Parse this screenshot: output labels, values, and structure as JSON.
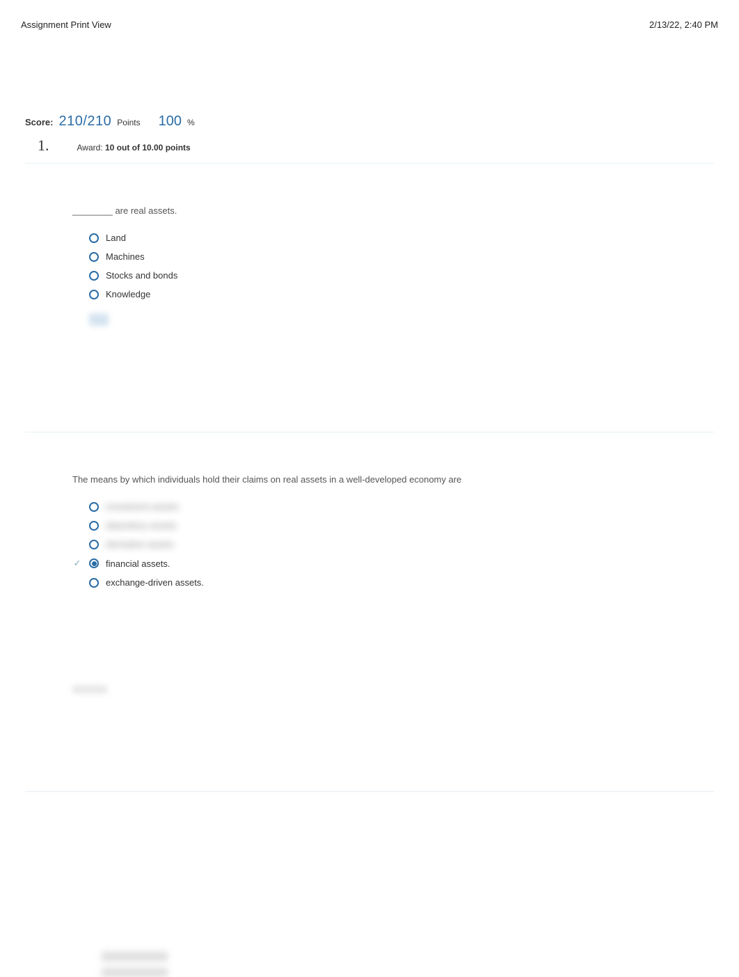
{
  "header": {
    "title": "Assignment Print View",
    "datetime": "2/13/22, 2:40 PM"
  },
  "score": {
    "label": "Score:",
    "value": "210/210",
    "points_label": "Points",
    "percent": "100",
    "percent_symbol": "%"
  },
  "question1": {
    "number": "1.",
    "award_prefix": "Award:",
    "award_value": "10 out of 10.00",
    "award_suffix": "points",
    "prompt": "________ are real assets.",
    "options": [
      {
        "label": "Land",
        "selected": false,
        "correct": false,
        "blurred": false
      },
      {
        "label": "Machines",
        "selected": false,
        "correct": false,
        "blurred": false
      },
      {
        "label": "Stocks and bonds",
        "selected": false,
        "correct": false,
        "blurred": false
      },
      {
        "label": "Knowledge",
        "selected": false,
        "correct": false,
        "blurred": false
      }
    ]
  },
  "question2": {
    "prompt": "The means by which individuals hold their claims on real assets in a well-developed economy are",
    "options": [
      {
        "label": "investment assets.",
        "selected": false,
        "correct": false,
        "blurred": true
      },
      {
        "label": "depository assets.",
        "selected": false,
        "correct": false,
        "blurred": true
      },
      {
        "label": "derivative assets.",
        "selected": false,
        "correct": false,
        "blurred": true
      },
      {
        "label": "financial assets.",
        "selected": true,
        "correct": true,
        "blurred": false
      },
      {
        "label": "exchange-driven assets.",
        "selected": false,
        "correct": false,
        "blurred": false
      }
    ]
  }
}
